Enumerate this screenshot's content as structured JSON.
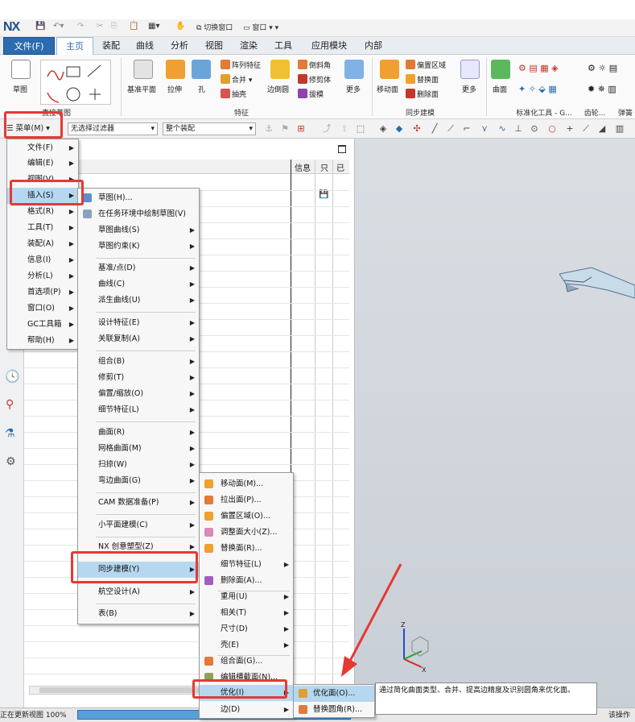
{
  "app": {
    "logo": "NX",
    "quick_access": {
      "switch_window": "切换窗口",
      "window": "窗口"
    }
  },
  "ribbon_tabs": [
    "文件(F)",
    "主页",
    "装配",
    "曲线",
    "分析",
    "视图",
    "渲染",
    "工具",
    "应用模块",
    "内部"
  ],
  "ribbon": {
    "sketch": "草图",
    "datum_plane": "基准平面",
    "extrude": "拉伸",
    "hole": "孔",
    "pattern_feature": "阵列特征",
    "unite": "合并",
    "shell": "抽壳",
    "blend": "边倒圆",
    "chamfer": "倒斜角",
    "trim_body": "修剪体",
    "draft": "拔模",
    "more": "更多",
    "move_face": "移动面",
    "offset_region": "偏置区域",
    "replace_face": "替换面",
    "delete_face": "删除面",
    "surface": "曲面",
    "groups": {
      "direct_sketch": "直接草图",
      "feature": "特征",
      "sync_modeling": "同步建模",
      "standard_tools": "标准化工具 - G...",
      "gear": "齿轮...",
      "spring": "弹簧"
    }
  },
  "filterbar": {
    "menu_button": "菜单(M)",
    "filter": "无选择过滤器",
    "scope": "整个装配"
  },
  "nav_panel": {
    "headers": [
      "信息",
      "只",
      "已"
    ]
  },
  "main_menu": [
    "文件(F)",
    "编辑(E)",
    "视图(V)",
    "插入(S)",
    "格式(R)",
    "工具(T)",
    "装配(A)",
    "信息(I)",
    "分析(L)",
    "首选项(P)",
    "窗口(O)",
    "GC工具箱",
    "帮助(H)"
  ],
  "insert_menu": [
    "草图(H)...",
    "在任务环境中绘制草图(V)",
    "草图曲线(S)",
    "草图约束(K)",
    "基准/点(D)",
    "曲线(C)",
    "派生曲线(U)",
    "设计特征(E)",
    "关联复制(A)",
    "组合(B)",
    "修剪(T)",
    "偏置/缩放(O)",
    "细节特征(L)",
    "曲面(R)",
    "网格曲面(M)",
    "扫掠(W)",
    "弯边曲面(G)",
    "CAM 数据准备(P)",
    "小平面建模(C)",
    "NX 创意塑型(Z)",
    "同步建模(Y)",
    "航空设计(A)",
    "表(B)"
  ],
  "sync_menu": [
    "移动面(M)...",
    "拉出面(P)...",
    "偏置区域(O)...",
    "调整面大小(Z)...",
    "替换面(R)...",
    "细节特征(L)",
    "删除面(A)...",
    "重用(U)",
    "相关(T)",
    "尺寸(D)",
    "壳(E)",
    "组合面(G)...",
    "编辑横截面(N)...",
    "优化(I)",
    "边(D)"
  ],
  "optimize_menu": [
    "优化面(O)...",
    "替换圆角(R)..."
  ],
  "tooltip": "通过简化曲面类型、合并、提高边精度及识别圆角来优化面。",
  "status": {
    "left": "正在更新视图 100%",
    "right": "该操作"
  },
  "colors": {
    "accent": "#2b6cb0",
    "highlight": "#b5d8f0",
    "annotation": "#e53935"
  }
}
